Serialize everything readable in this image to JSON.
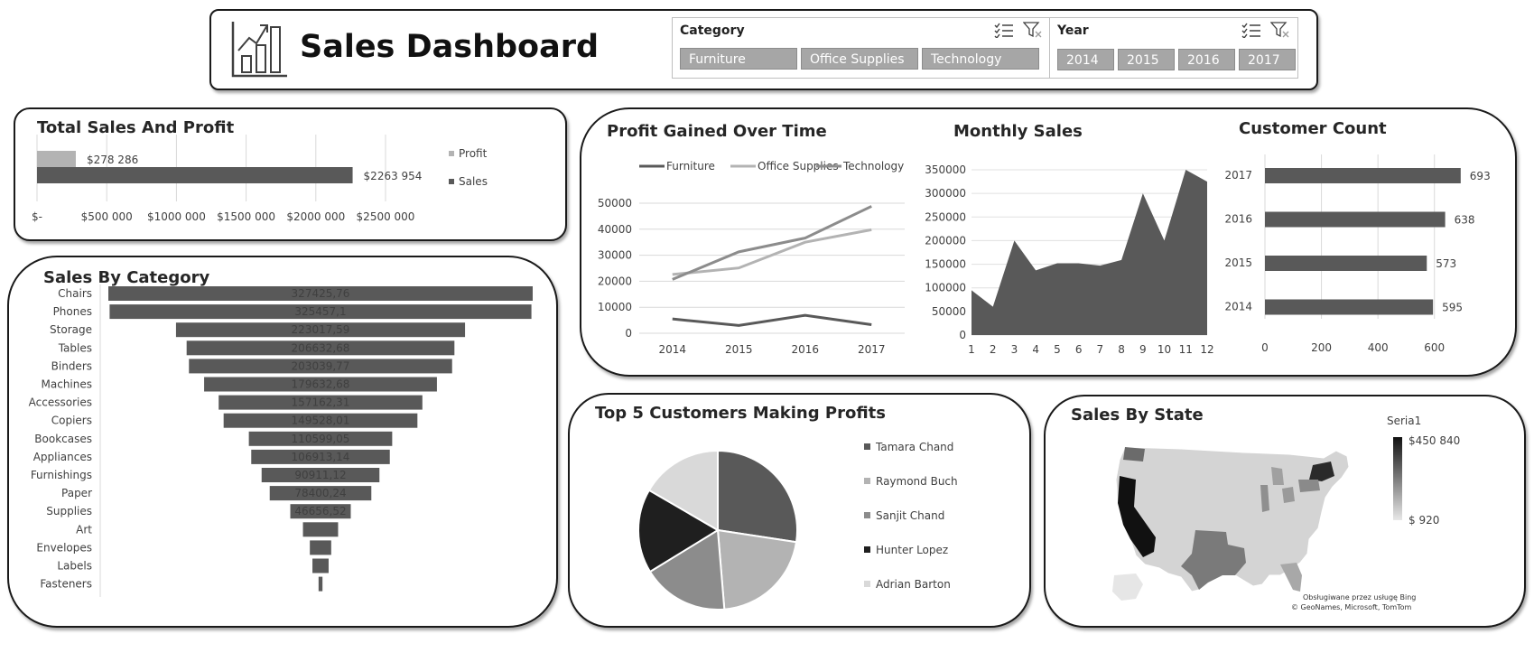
{
  "header": {
    "title": "Sales Dashboard",
    "category_slicer": {
      "title": "Category",
      "items": [
        "Furniture",
        "Office Supplies",
        "Technology"
      ]
    },
    "year_slicer": {
      "title": "Year",
      "items": [
        "2014",
        "2015",
        "2016",
        "2017"
      ]
    }
  },
  "colors": {
    "dark": "#595959",
    "mid": "#7f7f7f",
    "light": "#b3b3b3",
    "lighter": "#d9d9d9",
    "black": "#1a1a1a"
  },
  "panels": {
    "total": "Total Sales And Profit",
    "category": "Sales By Category",
    "profit": "Profit Gained Over Time",
    "monthly": "Monthly Sales",
    "customer": "Customer Count",
    "top5": "Top 5 Customers Making Profits",
    "state": "Sales By State"
  },
  "chart_data": [
    {
      "id": "total",
      "type": "bar",
      "orientation": "horizontal",
      "title": "Total Sales And Profit",
      "series": [
        {
          "name": "Profit",
          "value": 278286,
          "label": "$278 286"
        },
        {
          "name": "Sales",
          "value": 2263954,
          "label": "$2263 954"
        }
      ],
      "xlim": [
        0,
        2500000
      ],
      "xticks": [
        "$-",
        "$500 000",
        "$1000 000",
        "$1500 000",
        "$2000 000",
        "$2500 000"
      ],
      "legend": [
        "Profit",
        "Sales"
      ],
      "legend_position": "right"
    },
    {
      "id": "category",
      "type": "bar",
      "orientation": "horizontal funnel",
      "title": "Sales By Category",
      "categories": [
        "Chairs",
        "Phones",
        "Storage",
        "Tables",
        "Binders",
        "Machines",
        "Accessories",
        "Copiers",
        "Bookcases",
        "Appliances",
        "Furnishings",
        "Paper",
        "Supplies",
        "Art",
        "Envelopes",
        "Labels",
        "Fasteners"
      ],
      "values": [
        327425.76,
        325457.1,
        223017.59,
        206632.68,
        203039.77,
        179632.68,
        157162.31,
        149528.01,
        110599.05,
        106913.14,
        90911.12,
        78400.24,
        46656.52,
        27118.79,
        16476.4,
        12486.31,
        3024.28
      ],
      "labels": [
        "327425,76",
        "325457,1",
        "223017,59",
        "206632,68",
        "203039,77",
        "179632,68",
        "157162,31",
        "149528,01",
        "110599,05",
        "106913,14",
        "90911,12",
        "78400,24",
        "46656,52",
        "",
        "",
        "",
        ""
      ]
    },
    {
      "id": "profit",
      "type": "line",
      "title": "Profit Gained Over Time",
      "x": [
        "2014",
        "2015",
        "2016",
        "2017"
      ],
      "series": [
        {
          "name": "Furniture",
          "values": [
            5500,
            3000,
            6900,
            3300
          ],
          "color": "#595959"
        },
        {
          "name": "Office Supplies",
          "values": [
            22600,
            25100,
            35000,
            39800
          ],
          "color": "#b3b3b3"
        },
        {
          "name": "Technology",
          "values": [
            20700,
            31300,
            36600,
            48800
          ],
          "color": "#8c8c8c"
        }
      ],
      "ylim": [
        0,
        50000
      ],
      "yticks": [
        "0",
        "10000",
        "20000",
        "30000",
        "40000",
        "50000"
      ],
      "legend_position": "top"
    },
    {
      "id": "monthly",
      "type": "area",
      "title": "Monthly Sales",
      "x": [
        "1",
        "2",
        "3",
        "4",
        "5",
        "6",
        "7",
        "8",
        "9",
        "10",
        "11",
        "12"
      ],
      "values": [
        95000,
        60000,
        200000,
        137000,
        152000,
        152000,
        147000,
        159000,
        300000,
        200000,
        350000,
        325000
      ],
      "ylim": [
        0,
        350000
      ],
      "yticks": [
        "0",
        "50000",
        "100000",
        "150000",
        "200000",
        "250000",
        "300000",
        "350000"
      ]
    },
    {
      "id": "customer",
      "type": "bar",
      "orientation": "horizontal",
      "title": "Customer Count",
      "categories": [
        "2017",
        "2016",
        "2015",
        "2014"
      ],
      "values": [
        693,
        638,
        573,
        595
      ],
      "xlim": [
        0,
        700
      ],
      "xticks": [
        "0",
        "200",
        "400",
        "600"
      ]
    },
    {
      "id": "top5",
      "type": "pie",
      "title": "Top 5 Customers Making Profits",
      "labels": [
        "Tamara Chand",
        "Raymond Buch",
        "Sanjit Chand",
        "Hunter Lopez",
        "Adrian Barton"
      ],
      "values": [
        8981,
        6976,
        5757,
        5622,
        5444
      ],
      "colors": [
        "#595959",
        "#b3b3b3",
        "#8c8c8c",
        "#1f1f1f",
        "#d9d9d9"
      ],
      "legend_position": "right"
    },
    {
      "id": "state",
      "type": "map",
      "title": "Sales By State",
      "legend_title": "Seria1",
      "legend_max": "$450 840",
      "legend_min": "$ 920",
      "credit_line1": "Obsługiwane przez usługę Bing",
      "credit_line2": "© GeoNames, Microsoft, TomTom"
    }
  ]
}
